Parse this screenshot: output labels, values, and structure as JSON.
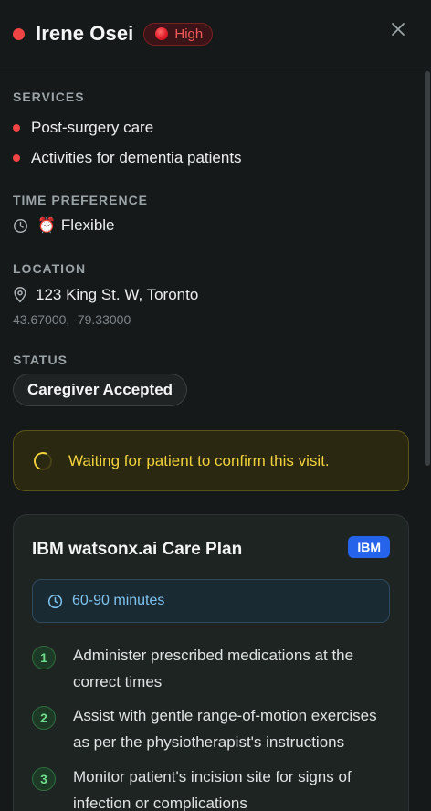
{
  "header": {
    "patient_name": "Irene Osei",
    "priority": "High",
    "status_dot_color": "#ef4444",
    "close_icon": "close-icon"
  },
  "services": {
    "label": "SERVICES",
    "items": [
      "Post-surgery care",
      "Activities for dementia patients"
    ]
  },
  "time_preference": {
    "label": "TIME PREFERENCE",
    "emoji": "⏰",
    "value": "Flexible",
    "icon": "clock-icon"
  },
  "location": {
    "label": "LOCATION",
    "address": "123 King St. W, Toronto",
    "coordinates": "43.67000, -79.33000",
    "icon": "map-pin-icon"
  },
  "status": {
    "label": "STATUS",
    "value": "Caregiver Accepted"
  },
  "waiting_notice": {
    "text": "Waiting for patient to confirm this visit.",
    "icon": "spinner-icon"
  },
  "care_plan": {
    "title": "IBM watsonx.ai Care Plan",
    "badge": "IBM",
    "duration": "60-90 minutes",
    "steps": [
      {
        "number": "1",
        "text": "Administer prescribed medications at the correct times"
      },
      {
        "number": "2",
        "text": "Assist with gentle range-of-motion exercises as per the physiotherapist's instructions"
      },
      {
        "number": "3",
        "text": "Monitor patient's incision site for signs of infection or complications"
      }
    ]
  },
  "colors": {
    "accent_red": "#ef4444",
    "warning_yellow": "#f1d23d",
    "info_blue": "#7ec3ee",
    "success_green": "#6fdc8c",
    "ibm_blue": "#2563eb"
  }
}
